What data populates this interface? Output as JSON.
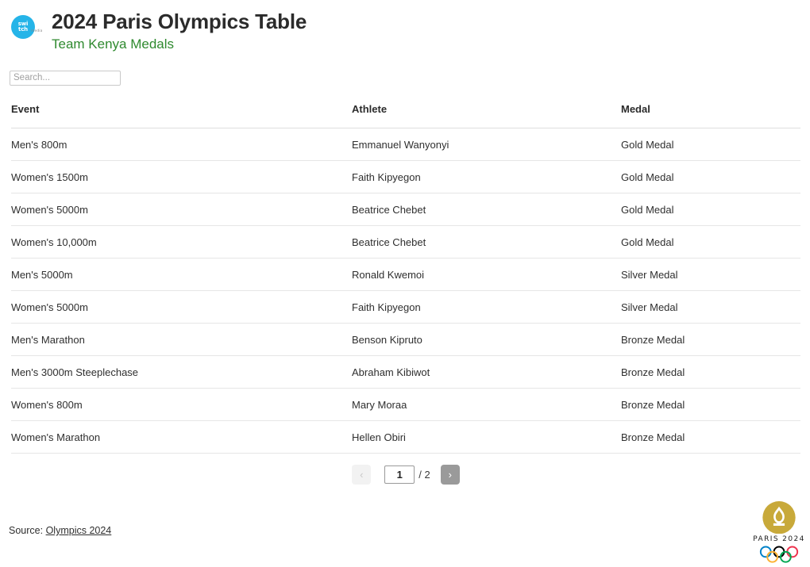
{
  "header": {
    "title": "2024 Paris Olympics Table",
    "subtitle": "Team Kenya Medals",
    "logo": {
      "line1": "swi",
      "line2": "tch",
      "sub": "media",
      "color": "#25b4e8"
    },
    "accent_green": "#2f8a2f"
  },
  "search": {
    "placeholder": "Search...",
    "value": ""
  },
  "table": {
    "columns": [
      "Event",
      "Athlete",
      "Medal"
    ],
    "rows": [
      {
        "event": "Men's 800m",
        "athlete": "Emmanuel Wanyonyi",
        "medal": "Gold Medal"
      },
      {
        "event": "Women's 1500m",
        "athlete": "Faith Kipyegon",
        "medal": "Gold Medal"
      },
      {
        "event": "Women's 5000m",
        "athlete": "Beatrice Chebet",
        "medal": "Gold Medal"
      },
      {
        "event": "Women's 10,000m",
        "athlete": "Beatrice Chebet",
        "medal": "Gold Medal"
      },
      {
        "event": "Men's 5000m",
        "athlete": "Ronald Kwemoi",
        "medal": "Silver Medal"
      },
      {
        "event": "Women's 5000m",
        "athlete": "Faith Kipyegon",
        "medal": "Silver Medal"
      },
      {
        "event": "Men's Marathon",
        "athlete": "Benson Kipruto",
        "medal": "Bronze Medal"
      },
      {
        "event": "Men's 3000m Steeplechase",
        "athlete": "Abraham Kibiwot",
        "medal": "Bronze Medal"
      },
      {
        "event": "Women's 800m",
        "athlete": "Mary Moraa",
        "medal": "Bronze Medal"
      },
      {
        "event": "Women's Marathon",
        "athlete": "Hellen Obiri",
        "medal": "Bronze Medal"
      }
    ]
  },
  "pagination": {
    "prev_label": "‹",
    "next_label": "›",
    "current_page": "1",
    "total_label": "/ 2"
  },
  "footer": {
    "source_prefix": "Source:",
    "source_link": "Olympics 2024"
  },
  "emblem": {
    "wordmark": "PARIS 2024",
    "gold": "#c8a93a",
    "ring_colors": [
      "#0081c8",
      "#000000",
      "#ee334e",
      "#fcb131",
      "#00a651"
    ]
  }
}
